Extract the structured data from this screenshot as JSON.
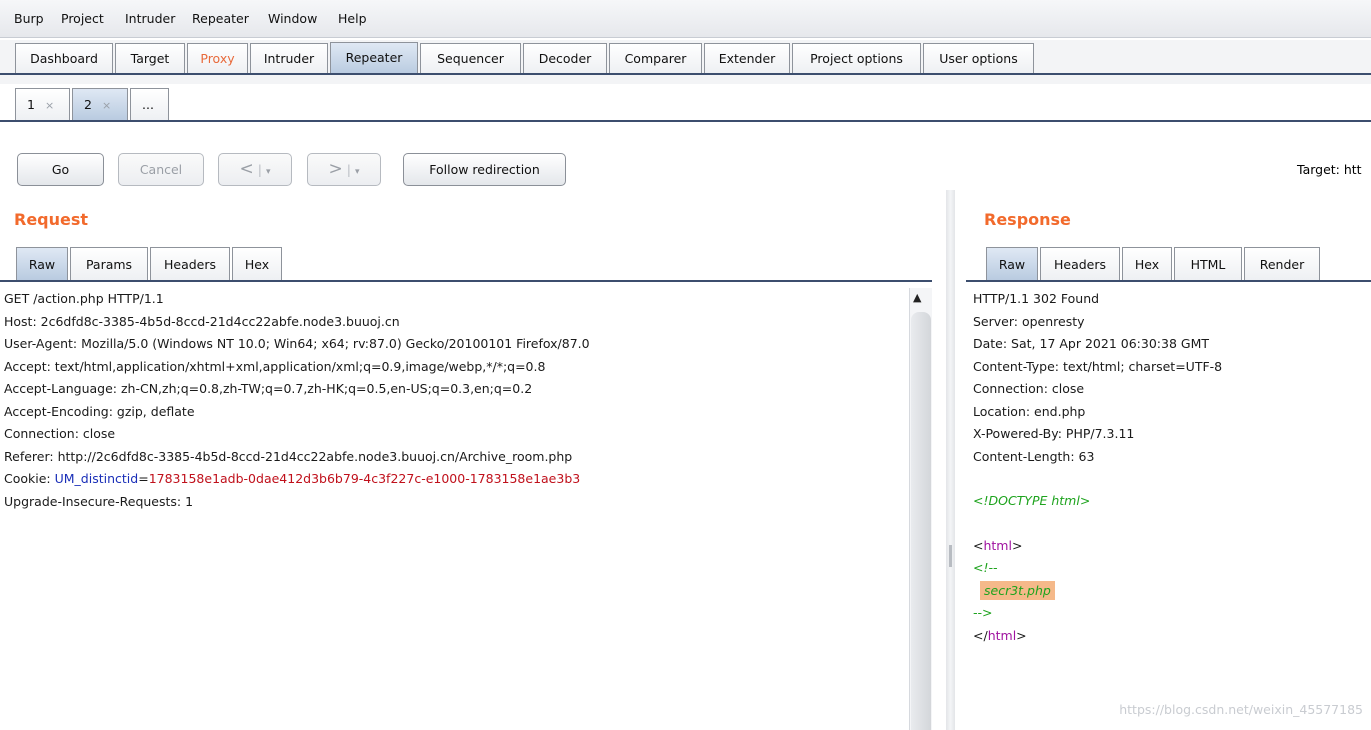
{
  "menu": [
    "Burp",
    "Project",
    "Intruder",
    "Repeater",
    "Window",
    "Help"
  ],
  "main_tabs": [
    "Dashboard",
    "Target",
    "Proxy",
    "Intruder",
    "Repeater",
    "Sequencer",
    "Decoder",
    "Comparer",
    "Extender",
    "Project options",
    "User options"
  ],
  "active_main_tab": "Repeater",
  "sub_tabs": [
    {
      "label": "1",
      "close": "×"
    },
    {
      "label": "2",
      "close": "×"
    },
    {
      "label": "..."
    }
  ],
  "toolbar": {
    "go": "Go",
    "cancel": "Cancel",
    "back": "<",
    "forward": ">",
    "dropdown": "▾",
    "follow": "Follow redirection",
    "target_label": "Target: htt"
  },
  "request": {
    "title": "Request",
    "tabs": [
      "Raw",
      "Params",
      "Headers",
      "Hex"
    ],
    "lines": [
      "GET /action.php HTTP/1.1",
      "Host: 2c6dfd8c-3385-4b5d-8ccd-21d4cc22abfe.node3.buuoj.cn",
      "User-Agent: Mozilla/5.0 (Windows NT 10.0; Win64; x64; rv:87.0) Gecko/20100101 Firefox/87.0",
      "Accept: text/html,application/xhtml+xml,application/xml;q=0.9,image/webp,*/*;q=0.8",
      "Accept-Language: zh-CN,zh;q=0.8,zh-TW;q=0.7,zh-HK;q=0.5,en-US;q=0.3,en;q=0.2",
      "Accept-Encoding: gzip, deflate",
      "Connection: close",
      "Referer: http://2c6dfd8c-3385-4b5d-8ccd-21d4cc22abfe.node3.buuoj.cn/Archive_room.php"
    ],
    "cookie_prefix": "Cookie: ",
    "cookie_name": "UM_distinctid",
    "cookie_eq": "=",
    "cookie_value": "1783158e1adb-0dae412d3b6b79-4c3f227c-e1000-1783158e1ae3b3",
    "last_line": "Upgrade-Insecure-Requests: 1"
  },
  "response": {
    "title": "Response",
    "tabs": [
      "Raw",
      "Headers",
      "Hex",
      "HTML",
      "Render"
    ],
    "lines": [
      "HTTP/1.1 302 Found",
      "Server: openresty",
      "Date: Sat, 17 Apr 2021 06:30:38 GMT",
      "Content-Type: text/html; charset=UTF-8",
      "Connection: close",
      "Location: end.php",
      "X-Powered-By: PHP/7.3.11",
      "Content-Length: 63"
    ],
    "doctype": "<!DOCTYPE html>",
    "html_open_lt": "<",
    "html_tag": "html",
    "html_gt": ">",
    "comment_open": "<!--",
    "comment_text": "secr3t.php",
    "comment_close": "-->",
    "html_close_lt": "</",
    "html_close_tag": "html",
    "html_close_gt": ">"
  },
  "watermark": "https://blog.csdn.net/weixin_45577185"
}
